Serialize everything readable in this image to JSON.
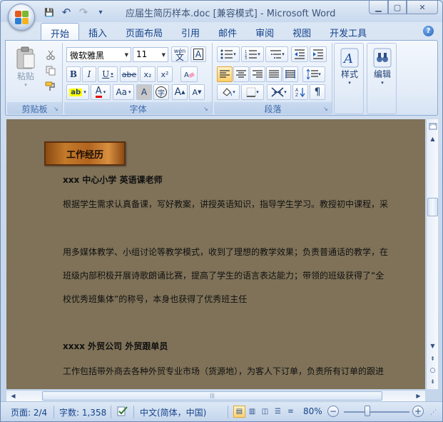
{
  "window": {
    "title": "应届生简历样本.doc [兼容模式] - Microsoft Word",
    "controls": {
      "minimize": "▁",
      "maximize": "▢",
      "close": "✕"
    }
  },
  "quick_access": {
    "save": "💾",
    "undo": "↶",
    "redo": "↷",
    "more": "▾"
  },
  "tabs": [
    {
      "label": "开始",
      "active": true
    },
    {
      "label": "插入"
    },
    {
      "label": "页面布局"
    },
    {
      "label": "引用"
    },
    {
      "label": "邮件"
    },
    {
      "label": "审阅"
    },
    {
      "label": "视图"
    },
    {
      "label": "开发工具"
    }
  ],
  "help": "?",
  "ribbon": {
    "clipboard": {
      "label": "剪贴板",
      "paste": "粘贴"
    },
    "font": {
      "label": "字体",
      "family": "微软雅黑",
      "size": "11",
      "wen": "wén\n文",
      "A": "A",
      "bold": "B",
      "italic": "I",
      "underline": "U",
      "strike": "abe",
      "sub": "x₂",
      "sup": "x²",
      "aa": "Aa",
      "grow": "A",
      "shrink": "A",
      "char_shade": "A",
      "enclose": "字"
    },
    "paragraph": {
      "label": "段落"
    },
    "styles": {
      "label": "样式"
    },
    "editing": {
      "label": "编辑"
    }
  },
  "document": {
    "banner": "工作经历",
    "lines": [
      {
        "text": "xxx 中心小学          英语课老师",
        "bold": true
      },
      {
        "text": "根据学生需求认真备课，写好教案，讲授英语知识，指导学生学习。教授初中课程，采"
      },
      {
        "text": "用多媒体教学、小组讨论等教学模式，收到了理想的教学效果；负责普通话的教学，在"
      },
      {
        "text": "班级内部积极开展诗歌朗诵比赛，提高了学生的语言表达能力；带领的班级获得了“全"
      },
      {
        "text": "校优秀班集体”的称号，本身也获得了优秀班主任"
      },
      {
        "text": "xxxx 外贸公司         外贸跟单员",
        "bold": true
      },
      {
        "text": "工作包括带外商去各种外贸专业市场（货源地），为客人下订单，负责所有订单的跟进"
      }
    ]
  },
  "status": {
    "page": "页面: 2/4",
    "words": "字数: 1,358",
    "language": "中文(简体，中国)",
    "zoom": "80%"
  },
  "colors": {
    "doc_background": "#7f7258",
    "banner": "#c47a2a",
    "ribbon_text": "#15428b"
  }
}
